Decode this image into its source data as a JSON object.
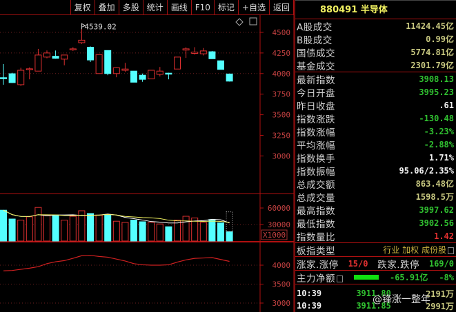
{
  "toolbar": [
    "复权",
    "叠加",
    "多股",
    "统计",
    "画线",
    "F10",
    "标记",
    "+自选",
    "返回"
  ],
  "panel": {
    "title": "880491 半导体",
    "turnover": [
      {
        "label": "A股成交",
        "value": "11424.45亿"
      },
      {
        "label": "B股成交",
        "value": "0.99亿"
      },
      {
        "label": "国债成交",
        "value": "5774.81亿"
      },
      {
        "label": "基金成交",
        "value": "2301.79亿"
      }
    ],
    "stats": [
      {
        "label": "最新指数",
        "value": "3908.13",
        "color": "g"
      },
      {
        "label": "今日开盘",
        "value": "3995.23",
        "color": "g"
      },
      {
        "label": "昨日收盘",
        "value": ".61",
        "color": "w"
      },
      {
        "label": "指数涨跌",
        "value": "-130.48",
        "color": "g"
      },
      {
        "label": "指数涨幅",
        "value": "-3.23%",
        "color": "g"
      },
      {
        "label": "平均涨幅",
        "value": "-2.88%",
        "color": "g"
      },
      {
        "label": "指数换手",
        "value": "1.71%",
        "color": "w"
      },
      {
        "label": "指数振幅",
        "value": "95.06/2.35%",
        "color": "w"
      },
      {
        "label": "总成交额",
        "value": "863.48亿",
        "color": "y"
      },
      {
        "label": "总成交量",
        "value": "1598.5万",
        "color": "y"
      },
      {
        "label": "最高指数",
        "value": "3997.62",
        "color": "g"
      },
      {
        "label": "最低指数",
        "value": "3902.56",
        "color": "g"
      },
      {
        "label": "指数量比",
        "value": "1.42",
        "color": "r"
      }
    ],
    "type_label": "板指类型",
    "type_value": "行业 加权 成份股",
    "up_label": "涨家.涨停",
    "up_value": "15/0",
    "down_label": "跌家.跌停",
    "down_value": "169/0",
    "flow_label": "主力净额",
    "flow_value": "-65.91亿",
    "flow_pct": "-8%",
    "ticks": [
      {
        "time": "10:39",
        "price": "3911.80",
        "vol": "2191万"
      },
      {
        "time": "10:39",
        "price": "3911.85",
        "vol": "2991万"
      }
    ],
    "watermark": "@锋涨一整年"
  },
  "chart_data": {
    "type": "candlestick",
    "high_label": "4539.02",
    "price_axis": [
      "4500",
      "4250",
      "4000",
      "3750",
      "3500",
      "3250",
      "3000"
    ],
    "volume_axis": [
      "60000",
      "30000"
    ],
    "volume_unit": "X1000",
    "indicator_axis": [
      "4000",
      "3500",
      "3000"
    ],
    "candles": [
      [
        3950,
        3945,
        4115,
        3865
      ],
      [
        3998,
        3890,
        4010,
        3885
      ],
      [
        3865,
        4040,
        4070,
        3850
      ],
      [
        4052,
        4058,
        4075,
        3930
      ],
      [
        4030,
        4225,
        4300,
        4030
      ],
      [
        4200,
        4250,
        4280,
        4185
      ],
      [
        4210,
        4185,
        4280,
        4180
      ],
      [
        4175,
        4225,
        4225,
        4100
      ],
      [
        4290,
        4300,
        4320,
        4275
      ],
      [
        4375,
        4405,
        4539,
        4360
      ],
      [
        4320,
        4165,
        4330,
        4140
      ],
      [
        4000,
        4230,
        4230,
        4000
      ],
      [
        4280,
        4000,
        4280,
        3980
      ],
      [
        4000,
        4070,
        4075,
        3955
      ],
      [
        4040,
        4055,
        4130,
        4020
      ],
      [
        4030,
        3895,
        4030,
        3895
      ],
      [
        3980,
        3930,
        4000,
        3900
      ],
      [
        3935,
        4040,
        4040,
        3935
      ],
      [
        3990,
        4030,
        4080,
        3965
      ],
      [
        4005,
        4000,
        4010,
        3930
      ],
      [
        4055,
        4200,
        4200,
        4055
      ],
      [
        4285,
        4300,
        4320,
        4190
      ],
      [
        4245,
        4260,
        4320,
        4230
      ],
      [
        4240,
        4275,
        4310,
        4220
      ],
      [
        4265,
        4180,
        4275,
        4180
      ],
      [
        4155,
        4050,
        4160,
        4050
      ],
      [
        3995,
        3908,
        3998,
        3903
      ]
    ],
    "volumes": [
      56000,
      40000,
      38000,
      44000,
      61000,
      47000,
      47000,
      38000,
      45000,
      55000,
      50000,
      47000,
      48000,
      36000,
      34000,
      38000,
      35000,
      34000,
      31000,
      26000,
      38000,
      45000,
      42000,
      34000,
      39000,
      33000,
      17000
    ],
    "projected_volume": 53000,
    "indicator": [
      3850,
      3860,
      3890,
      3920,
      3960,
      4040,
      4090,
      4120,
      4180,
      4250,
      4260,
      4230,
      4210,
      4160,
      4110,
      4040,
      4010,
      4000,
      4000,
      4010,
      4080,
      4140,
      4180,
      4190,
      4200,
      4150,
      4100
    ],
    "colors": {
      "up": "#e03030",
      "down": "#54ffff",
      "ma5": "#ffffff",
      "ma10": "#f0f060",
      "axis": "#b01010",
      "indicator": "#d02020"
    }
  }
}
